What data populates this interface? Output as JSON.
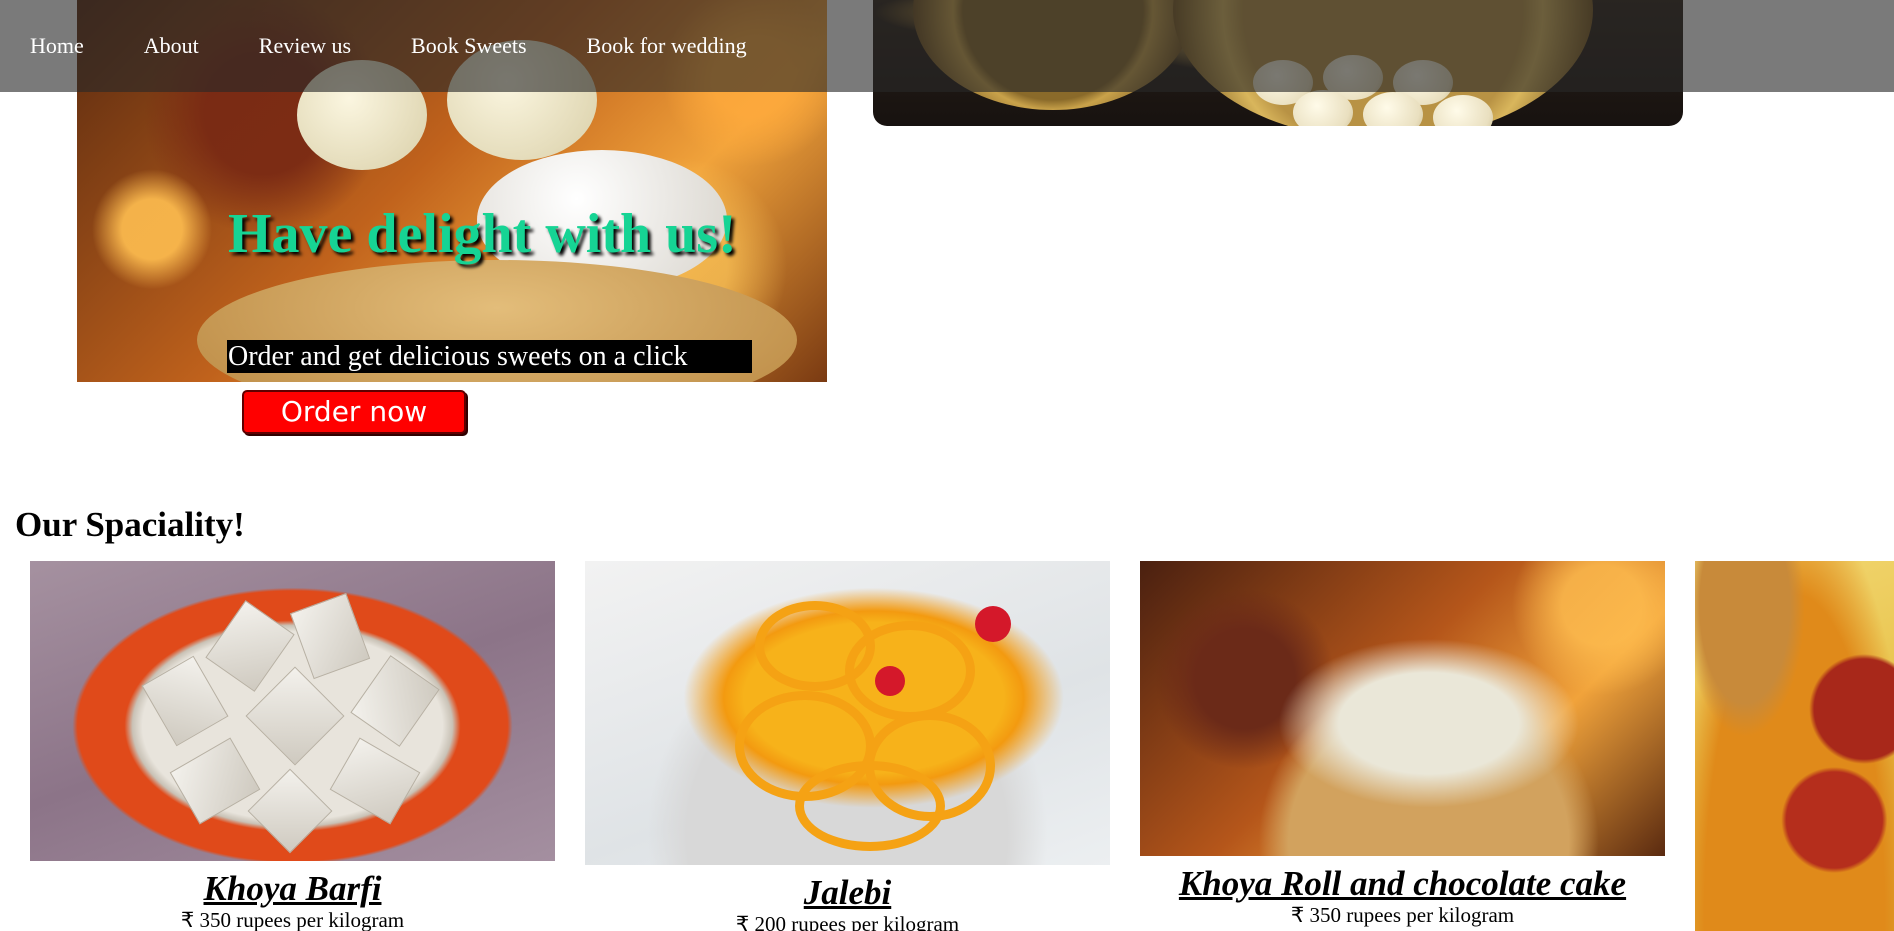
{
  "nav": {
    "items": [
      {
        "label": "Home"
      },
      {
        "label": "About"
      },
      {
        "label": "Review us"
      },
      {
        "label": "Book Sweets"
      },
      {
        "label": "Book for wedding"
      }
    ]
  },
  "hero": {
    "heading": "Have delight with us!",
    "subheading": "Order and get delicious sweets on a click",
    "order_button": "Order now"
  },
  "speciality": {
    "title": "Our Spaciality!",
    "products": [
      {
        "name": "Khoya Barfi",
        "price": "₹ 350 rupees per kilogram"
      },
      {
        "name": "Jalebi",
        "price": "₹ 200 rupees per kilogram"
      },
      {
        "name": "Khoya Roll and chocolate cake",
        "price": "₹ 350 rupees per kilogram"
      },
      {
        "name": "",
        "price": ""
      }
    ]
  },
  "colors": {
    "heading_accent": "#16d494",
    "order_button": "#ff0000",
    "navbar": "rgba(40,40,40,0.62)"
  }
}
